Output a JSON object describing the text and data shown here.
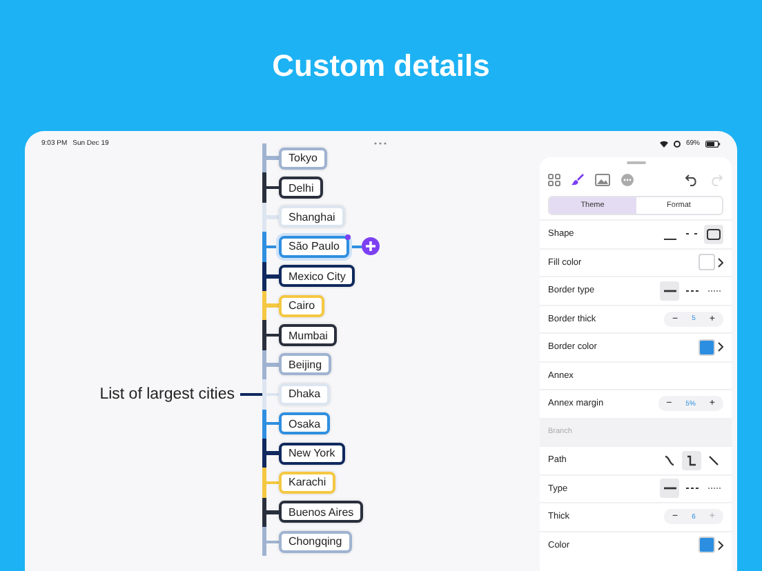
{
  "headline": "Custom details",
  "status_bar": {
    "time": "9:03 PM",
    "date": "Sun Dec 19",
    "battery": "69%"
  },
  "mind_map": {
    "root": "List of largest cities",
    "nodes": [
      {
        "label": "Tokyo",
        "color": "#9fb3d1",
        "selected": false
      },
      {
        "label": "Delhi",
        "color": "#2a2f3d",
        "selected": false
      },
      {
        "label": "Shanghai",
        "color": "#dce5f0",
        "selected": false
      },
      {
        "label": "São Paulo",
        "color": "#2f8fe0",
        "selected": true
      },
      {
        "label": "Mexico City",
        "color": "#10295e",
        "selected": false
      },
      {
        "label": "Cairo",
        "color": "#f5c842",
        "selected": false
      },
      {
        "label": "Mumbai",
        "color": "#2a2f3d",
        "selected": false
      },
      {
        "label": "Beijing",
        "color": "#9fb3d1",
        "selected": false
      },
      {
        "label": "Dhaka",
        "color": "#dce5f0",
        "selected": false
      },
      {
        "label": "Osaka",
        "color": "#2f8fe0",
        "selected": false
      },
      {
        "label": "New York",
        "color": "#10295e",
        "selected": false
      },
      {
        "label": "Karachi",
        "color": "#f5c842",
        "selected": false
      },
      {
        "label": "Buenos Aires",
        "color": "#2a2f3d",
        "selected": false
      },
      {
        "label": "Chongqing",
        "color": "#9fb3d1",
        "selected": false
      }
    ]
  },
  "panel": {
    "modes": [
      {
        "kind": "grid",
        "selected": false
      },
      {
        "kind": "brush",
        "selected": true
      },
      {
        "kind": "image",
        "selected": false
      },
      {
        "kind": "more",
        "selected": false
      }
    ],
    "actions": [
      {
        "kind": "undo",
        "disabled": false
      },
      {
        "kind": "redo",
        "disabled": true
      }
    ],
    "tabs": [
      {
        "label": "Theme",
        "selected": true
      },
      {
        "label": "Format",
        "selected": false
      }
    ],
    "rows": [
      {
        "kind": "options",
        "label": "Shape",
        "options": [
          {
            "kind": "underline",
            "selected": false
          },
          {
            "kind": "dashes",
            "selected": false
          },
          {
            "kind": "rect",
            "selected": true
          }
        ]
      },
      {
        "kind": "color",
        "label": "Fill color",
        "color": "#ffffff"
      },
      {
        "kind": "options",
        "label": "Border type",
        "options": [
          {
            "kind": "solid",
            "selected": true
          },
          {
            "kind": "dashed",
            "selected": false
          },
          {
            "kind": "dotted",
            "selected": false
          }
        ]
      },
      {
        "kind": "stepper",
        "label": "Border thick",
        "minus": "−",
        "value": "5",
        "plus": "+",
        "plus_disabled": false
      },
      {
        "kind": "color",
        "label": "Border color",
        "color": "#2b8ee0"
      },
      {
        "kind": "plain",
        "label": "Annex"
      },
      {
        "kind": "stepper",
        "label": "Annex margin",
        "minus": "−",
        "value": "5%",
        "plus": "+",
        "plus_disabled": false
      },
      {
        "kind": "section",
        "label": "Branch"
      },
      {
        "kind": "options",
        "label": "Path",
        "options": [
          {
            "kind": "curve",
            "selected": false
          },
          {
            "kind": "elbow",
            "selected": true
          },
          {
            "kind": "straight",
            "selected": false
          }
        ]
      },
      {
        "kind": "options",
        "label": "Type",
        "options": [
          {
            "kind": "solid",
            "selected": true
          },
          {
            "kind": "dashed",
            "selected": false
          },
          {
            "kind": "dotted",
            "selected": false
          }
        ]
      },
      {
        "kind": "stepper",
        "label": "Thick",
        "minus": "−",
        "value": "6",
        "plus": "+",
        "plus_disabled": true
      },
      {
        "kind": "color",
        "label": "Color",
        "color": "#2b8ee0"
      }
    ]
  }
}
